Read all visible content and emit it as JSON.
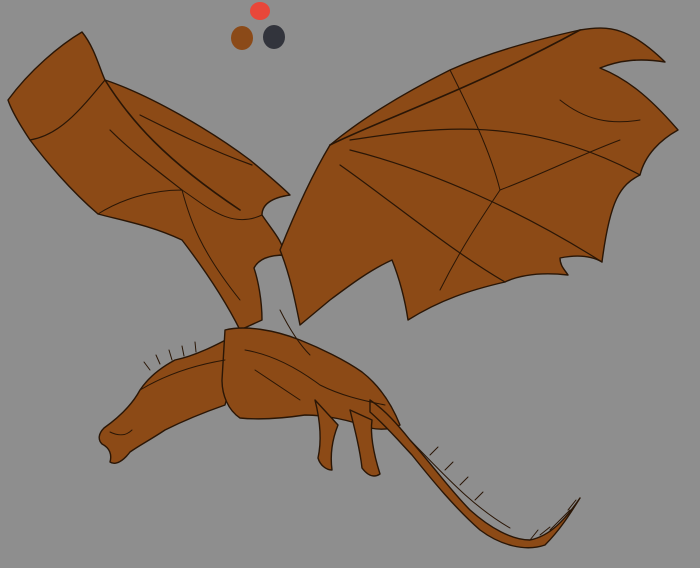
{
  "canvas": {
    "background_color": "#8e8e8e"
  },
  "palette": {
    "swatches": [
      {
        "name": "red-swatch",
        "color": "#e8473a"
      },
      {
        "name": "orange-brown-swatch",
        "color": "#8b4a18"
      },
      {
        "name": "dark-gray-swatch",
        "color": "#32343c"
      }
    ]
  },
  "dragon": {
    "fill_color": "#8c4a16",
    "line_color": "#2a1606"
  }
}
